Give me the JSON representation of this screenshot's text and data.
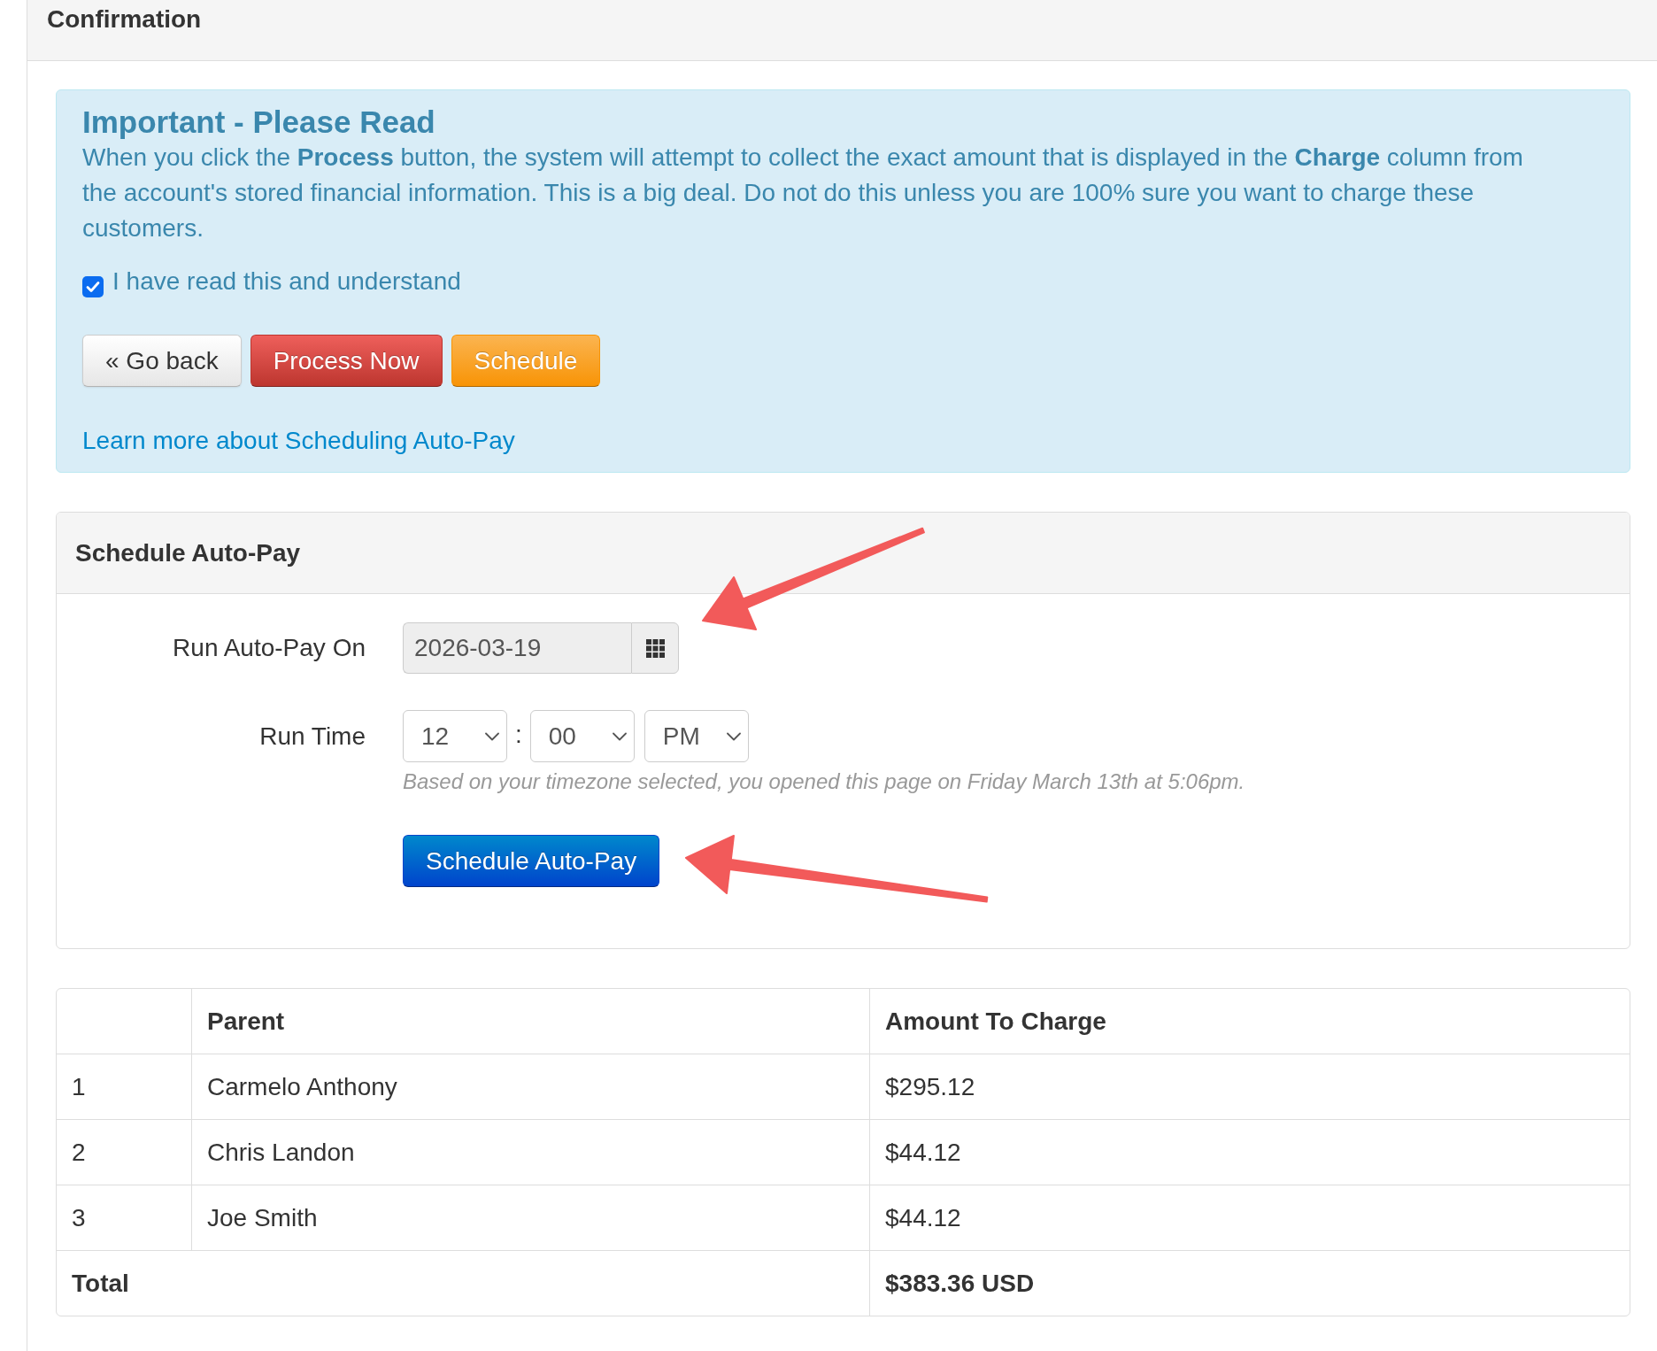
{
  "panel": {
    "title": "Confirmation"
  },
  "alert": {
    "heading": "Important - Please Read",
    "message": "When you click the **Process** button, the system will attempt to collect the exact amount that is displayed in the **Charge** column from the account's stored financial information. This is a big deal. Do not do this unless you are 100% sure you want to charge these customers.",
    "acknowledgement": {
      "label": "I have read this and understand",
      "checked": true
    },
    "buttons": [
      {
        "label": "« Go back",
        "kind": "default"
      },
      {
        "label": "Process Now",
        "kind": "danger"
      },
      {
        "label": "Schedule",
        "kind": "warning"
      }
    ],
    "link": "Learn more about Scheduling Auto-Pay"
  },
  "schedule_panel": {
    "title": "Schedule Auto-Pay",
    "date": {
      "label": "Run Auto-Pay On",
      "value": "2026-03-19",
      "readonly": true
    },
    "time": {
      "label": "Run Time",
      "hour": "12",
      "separator": ":",
      "minute": "00",
      "period": "PM"
    },
    "help": "Based on your timezone selected, you opened this page on Friday March 13th at 5:06pm.",
    "submit": "Schedule Auto-Pay"
  },
  "table": {
    "columns": [
      "Parent",
      "Amount To Charge"
    ],
    "rows": [
      {
        "number": "1",
        "parent": "Carmelo Anthony",
        "amount": "$295.12"
      },
      {
        "number": "2",
        "parent": "Chris Landon",
        "amount": "$44.12"
      },
      {
        "number": "3",
        "parent": "Joe Smith",
        "amount": "$44.12"
      }
    ],
    "total": {
      "label": "Total",
      "amount": "$383.36 USD"
    }
  },
  "annotations": [
    {
      "kind": "arrow"
    },
    {
      "kind": "arrow"
    }
  ]
}
